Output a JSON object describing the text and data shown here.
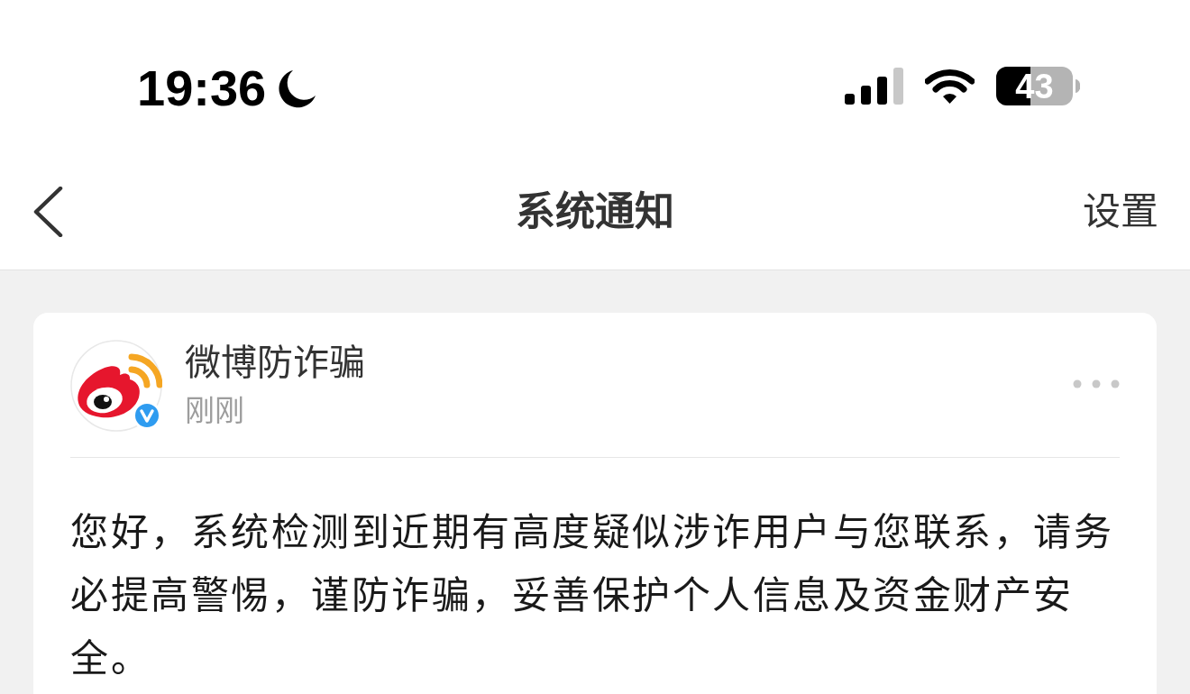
{
  "status_bar": {
    "time": "19:36",
    "battery": "43"
  },
  "header": {
    "title": "系统通知",
    "action": "设置"
  },
  "notifications": [
    {
      "sender": "微博防诈骗",
      "verified": true,
      "time": "刚刚",
      "text": "您好，系统检测到近期有高度疑似涉诈用户与您联系，请务必提高警惕，谨防诈骗，妥善保护个人信息及资金财产安全。"
    }
  ]
}
